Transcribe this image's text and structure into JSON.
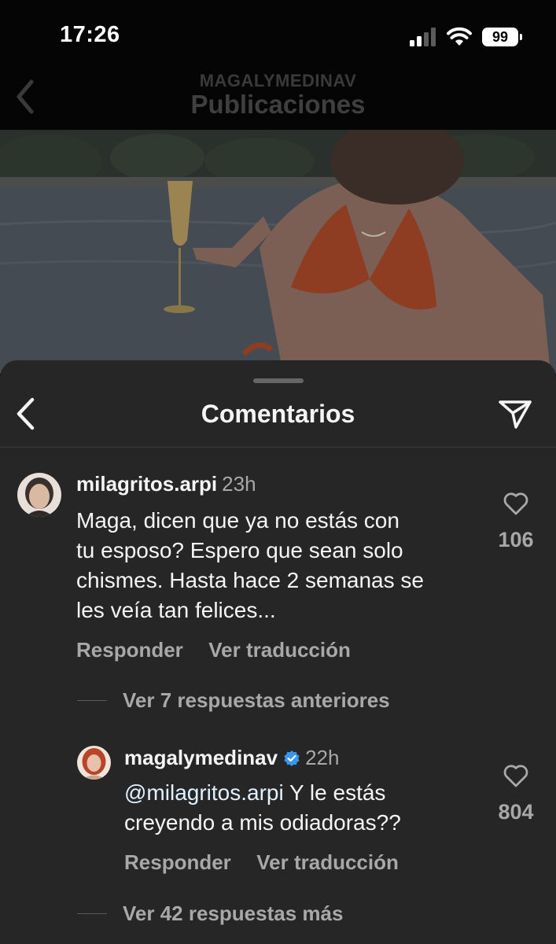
{
  "status_bar": {
    "time": "17:26",
    "battery": "99"
  },
  "header": {
    "username": "MAGALYMEDINAV",
    "title": "Publicaciones"
  },
  "comments_sheet": {
    "title": "Comentarios"
  },
  "comment": {
    "username": "milagritos.arpi",
    "time": "23h",
    "text_lines": [
      "Maga, dicen que ya no estás con",
      "tu esposo? Espero que sean solo",
      "chismes. Hasta hace 2 semanas se",
      "les veía tan felices..."
    ],
    "likes": "106",
    "reply_label": "Responder",
    "translate_label": "Ver traducción",
    "previous_replies": "Ver 7 respuestas anteriores"
  },
  "reply": {
    "username": "magalymedinav",
    "verified": true,
    "time": "22h",
    "mention": "@milagritos.arpi",
    "text_line1_rest": " Y le estás",
    "text_line2": "creyendo a mis odiadoras??",
    "likes": "804",
    "reply_label": "Responder",
    "translate_label": "Ver traducción"
  },
  "more_replies": "Ver 42 respuestas más",
  "colors": {
    "sheet_bg": "#262626",
    "secondary_text": "#a8a8a8",
    "verified_blue": "#3897f0"
  }
}
